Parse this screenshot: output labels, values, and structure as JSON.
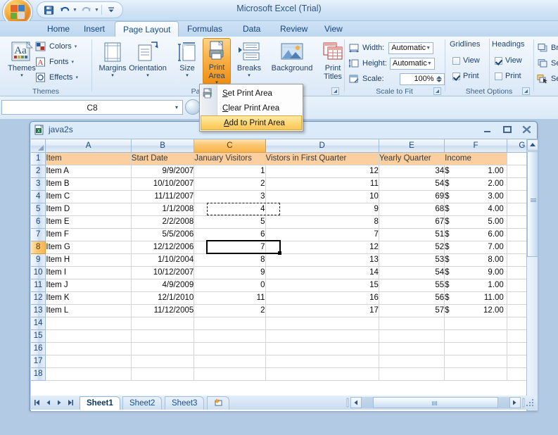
{
  "window": {
    "title": "Microsoft Excel (Trial)",
    "orb_name": "office-orb",
    "quick_access": [
      {
        "name": "save-icon",
        "label": "Save"
      },
      {
        "name": "undo-icon",
        "label": "Undo"
      },
      {
        "name": "redo-icon",
        "label": "Redo"
      },
      {
        "name": "customize-qat-icon",
        "label": "Customize Quick Access Toolbar"
      }
    ]
  },
  "ribbon": {
    "tabs": [
      {
        "label": "Home",
        "active": false
      },
      {
        "label": "Insert",
        "active": false
      },
      {
        "label": "Page Layout",
        "active": true
      },
      {
        "label": "Formulas",
        "active": false
      },
      {
        "label": "Data",
        "active": false
      },
      {
        "label": "Review",
        "active": false
      },
      {
        "label": "View",
        "active": false
      }
    ],
    "groups": {
      "themes": {
        "label": "Themes",
        "big": {
          "label": "Themes",
          "caret": "▾"
        },
        "items": [
          {
            "label": "Colors",
            "caret": "▾",
            "icon": "theme-colors-icon"
          },
          {
            "label": "Fonts",
            "caret": "▾",
            "icon": "theme-fonts-icon"
          },
          {
            "label": "Effects",
            "caret": "▾",
            "icon": "theme-effects-icon"
          }
        ]
      },
      "page_setup": {
        "label": "Pag",
        "buttons": [
          {
            "label": "Margins",
            "caret": "▾",
            "icon": "margins-icon",
            "pressed": false
          },
          {
            "label": "Orientation",
            "caret": "▾",
            "icon": "orientation-icon",
            "pressed": false
          },
          {
            "label": "Size",
            "caret": "▾",
            "icon": "size-icon",
            "pressed": false
          },
          {
            "label": "Print Area",
            "caret": "▾",
            "icon": "print-area-icon",
            "pressed": true
          },
          {
            "label": "Breaks",
            "caret": "▾",
            "icon": "breaks-icon",
            "pressed": false
          },
          {
            "label": "Background",
            "caret": "",
            "icon": "background-icon",
            "pressed": false
          },
          {
            "label": "Print Titles",
            "caret": "",
            "icon": "print-titles-icon",
            "pressed": false
          }
        ]
      },
      "scale_to_fit": {
        "label": "Scale to Fit",
        "rows": [
          {
            "label": "Width:",
            "value": "Automatic",
            "icon": "fit-width-icon",
            "kind": "combo"
          },
          {
            "label": "Height:",
            "value": "Automatic",
            "icon": "fit-height-icon",
            "kind": "combo"
          },
          {
            "label": "Scale:",
            "value": "100%",
            "icon": "scale-icon",
            "kind": "spin"
          }
        ]
      },
      "sheet_options": {
        "label": "Sheet Options",
        "col_headers": [
          "Gridlines",
          "Headings"
        ],
        "rows": [
          {
            "label": "View",
            "gridlines_checked": false,
            "headings_checked": true
          },
          {
            "label": "Print",
            "gridlines_checked": true,
            "headings_checked": false
          }
        ]
      },
      "arrange": {
        "label": "",
        "items": [
          {
            "label": "Br",
            "icon": "bring-to-front-icon"
          },
          {
            "label": "Se",
            "icon": "send-to-back-icon"
          },
          {
            "label": "Se",
            "icon": "selection-pane-icon"
          }
        ]
      }
    }
  },
  "menu": {
    "name": "print-area-dropdown",
    "items": [
      {
        "accel": "S",
        "rest": "et Print Area",
        "highlighted": false,
        "icon": "set-print-area-icon"
      },
      {
        "accel": "C",
        "rest": "lear Print Area",
        "highlighted": false,
        "icon": ""
      },
      {
        "accel": "A",
        "rest": "dd to Print Area",
        "highlighted": true,
        "icon": ""
      }
    ]
  },
  "formula_bar": {
    "name_box_value": "C8",
    "name_box_caret": "▾",
    "formula_value": ""
  },
  "workbook": {
    "title": "java2s",
    "window_buttons": [
      {
        "name": "minimize-button",
        "glyph": "–"
      },
      {
        "name": "maximize-button",
        "glyph": "□"
      },
      {
        "name": "close-button",
        "glyph": "✕"
      }
    ],
    "sheet_tabs": [
      {
        "label": "Sheet1",
        "active": true
      },
      {
        "label": "Sheet2",
        "active": false
      },
      {
        "label": "Sheet3",
        "active": false
      },
      {
        "label": "",
        "active": false
      }
    ],
    "nav_buttons": [
      "first-sheet",
      "previous-sheet",
      "next-sheet",
      "last-sheet"
    ]
  },
  "grid": {
    "column_headers": [
      "A",
      "B",
      "C",
      "D",
      "E",
      "F",
      "G"
    ],
    "selected_column": "C",
    "selected_row": 8,
    "active_cell": "C8",
    "marching_ants_cell": "C5",
    "row_numbers": [
      1,
      2,
      3,
      4,
      5,
      6,
      7,
      8,
      9,
      10,
      11,
      12,
      13,
      14,
      15,
      16,
      17,
      18
    ],
    "header_row": [
      "Item",
      "Start Date",
      "January Visitors",
      "Vistors in First Quarter",
      "Yearly Quarter",
      "Income",
      ""
    ],
    "rows": [
      {
        "r": 2,
        "a": "Item A",
        "b": "9/9/2007",
        "c": "1",
        "d": "12",
        "e": "34",
        "f": "1.00"
      },
      {
        "r": 3,
        "a": "Item B",
        "b": "10/10/2007",
        "c": "2",
        "d": "11",
        "e": "54",
        "f": "2.00"
      },
      {
        "r": 4,
        "a": "Item C",
        "b": "11/11/2007",
        "c": "3",
        "d": "10",
        "e": "69",
        "f": "3.00"
      },
      {
        "r": 5,
        "a": "Item D",
        "b": "1/1/2008",
        "c": "4",
        "d": "9",
        "e": "68",
        "f": "4.00"
      },
      {
        "r": 6,
        "a": "Item E",
        "b": "2/2/2008",
        "c": "5",
        "d": "8",
        "e": "67",
        "f": "5.00"
      },
      {
        "r": 7,
        "a": "Item F",
        "b": "5/5/2006",
        "c": "6",
        "d": "7",
        "e": "51",
        "f": "6.00"
      },
      {
        "r": 8,
        "a": "Item G",
        "b": "12/12/2006",
        "c": "7",
        "d": "12",
        "e": "52",
        "f": "7.00"
      },
      {
        "r": 9,
        "a": "Item H",
        "b": "1/10/2004",
        "c": "8",
        "d": "13",
        "e": "53",
        "f": "8.00"
      },
      {
        "r": 10,
        "a": "Item I",
        "b": "10/12/2007",
        "c": "9",
        "d": "14",
        "e": "54",
        "f": "9.00"
      },
      {
        "r": 11,
        "a": "Item J",
        "b": "4/9/2009",
        "c": "0",
        "d": "15",
        "e": "55",
        "f": "1.00"
      },
      {
        "r": 12,
        "a": "Item K",
        "b": "12/1/2010",
        "c": "11",
        "d": "16",
        "e": "56",
        "f": "11.00"
      },
      {
        "r": 13,
        "a": "Item L",
        "b": "11/12/2005",
        "c": "2",
        "d": "17",
        "e": "57",
        "f": "12.00"
      },
      {
        "r": 14,
        "a": "",
        "b": "",
        "c": "",
        "d": "",
        "e": "",
        "f": ""
      },
      {
        "r": 15,
        "a": "",
        "b": "",
        "c": "",
        "d": "",
        "e": "",
        "f": ""
      },
      {
        "r": 16,
        "a": "",
        "b": "",
        "c": "",
        "d": "",
        "e": "",
        "f": ""
      },
      {
        "r": 17,
        "a": "",
        "b": "",
        "c": "",
        "d": "",
        "e": "",
        "f": ""
      },
      {
        "r": 18,
        "a": "",
        "b": "",
        "c": "",
        "d": "",
        "e": "",
        "f": ""
      }
    ],
    "currency_symbol": "$"
  },
  "colors": {
    "accent_orange": "#f8b64f",
    "header_fill": "#fbcfa0",
    "chrome_blue": "#b3cae5",
    "text_blue": "#1a4d85"
  }
}
